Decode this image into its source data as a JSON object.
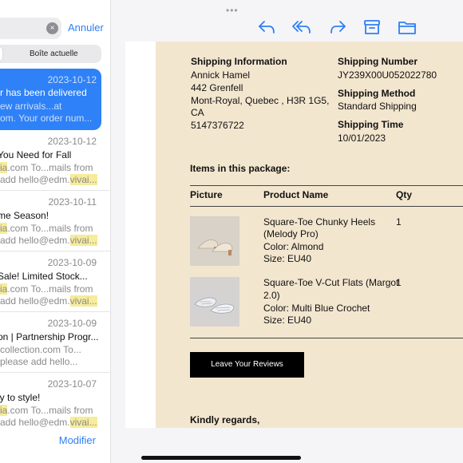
{
  "search": {
    "clear_glyph": "×",
    "cancel_label": "Annuler"
  },
  "segment": {
    "right_label": "Boîte actuelle"
  },
  "mails": [
    {
      "date": "2023-10-12",
      "subject": "r has been delivered",
      "line1": "ew arrivals...at",
      "line2": "om. Your order num...",
      "hl1": "",
      "hl2": "",
      "selected": true
    },
    {
      "date": "2023-10-12",
      "subject": "You Need for Fall",
      "line1_hl": "ia",
      "line1": ".com To...mails from",
      "line2_pre": "add hello@edm.",
      "line2_hl": "vivai...",
      "selected": false
    },
    {
      "date": "2023-10-11",
      "subject": "me Season!",
      "line1_hl": "ia",
      "line1": ".com To...mails from",
      "line2_pre": "add hello@edm.",
      "line2_hl": "vivai...",
      "selected": false
    },
    {
      "date": "2023-10-09",
      "subject": "Sale! Limited Stock...",
      "line1_hl": "ia",
      "line1": ".com To...mails from",
      "line2_pre": "add hello@edm.",
      "line2_hl": "vivai...",
      "selected": false
    },
    {
      "date": "2023-10-09",
      "subject": "on | Partnership Progr...",
      "line1_hl": "",
      "line1": "collection.com To...",
      "line2_pre": "   please add hello...",
      "line2_hl": "",
      "selected": false
    },
    {
      "date": "2023-10-07",
      "subject": "ly to style!",
      "line1_hl": "ia",
      "line1": ".com To...mails from",
      "line2_pre": "add hello@edm.",
      "line2_hl": "vivai...",
      "selected": false
    }
  ],
  "footer": {
    "modify_label": "Modifier"
  },
  "toolbar": {
    "grabber": "•••",
    "icons": [
      "reply-icon",
      "reply-all-icon",
      "forward-icon",
      "archive-icon",
      "folder-icon"
    ],
    "accent": "#2f7ff5"
  },
  "email": {
    "shipping_info_heading": "Shipping Information",
    "name": "Annick Hamel",
    "address1": "442 Grenfell",
    "address2": "Mont-Royal, Quebec , H3R 1G5,",
    "address3": "CA",
    "phone": "5147376722",
    "shipping_number_heading": "Shipping Number",
    "shipping_number": "JY239X00U052022780",
    "shipping_method_heading": "Shipping Method",
    "shipping_method": "Standard Shipping",
    "shipping_time_heading": "Shipping Time",
    "shipping_time": "10/01/2023",
    "items_heading": "Items in this package:",
    "col_picture": "Picture",
    "col_product": "Product Name",
    "col_qty": "Qty",
    "products": [
      {
        "name1": "Square-Toe Chunky Heels",
        "name2": "(Melody Pro)",
        "color": "Color: Almond",
        "size": "Size: EU40",
        "qty": "1"
      },
      {
        "name1": "Square-Toe V-Cut Flats (Margot",
        "name2": "2.0)",
        "color": "Color: Multi Blue Crochet",
        "size": "Size: EU40",
        "qty": "1"
      }
    ],
    "cta_label": "Leave Your Reviews",
    "closing": "Kindly regards,"
  }
}
